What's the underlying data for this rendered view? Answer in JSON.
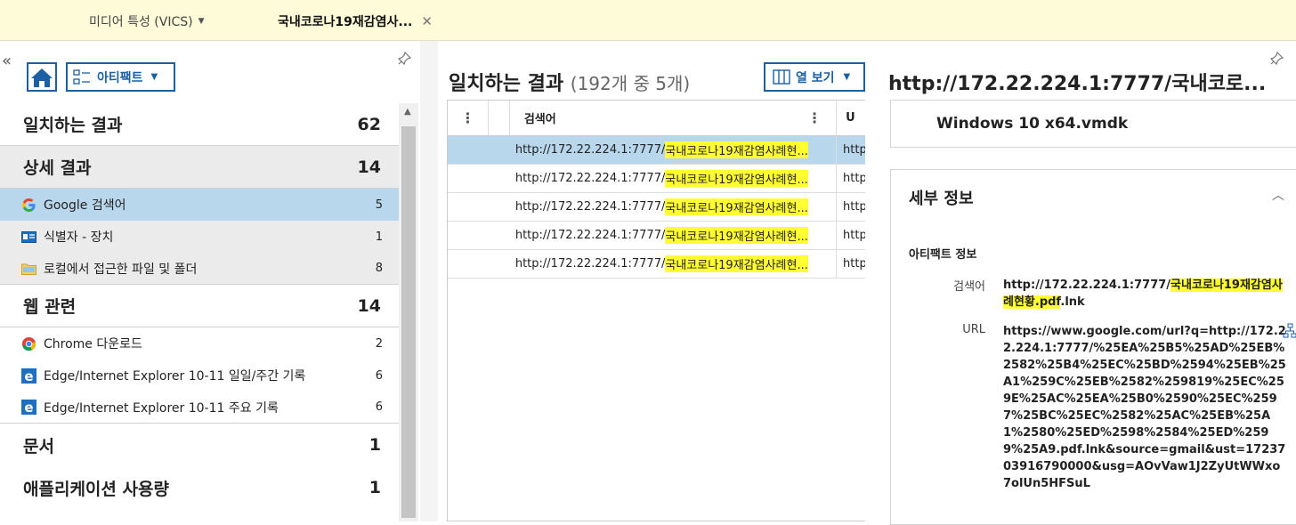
{
  "tabs": [
    {
      "label": "미디어 특성 (VICS)"
    },
    {
      "label": "국내코로나19재감염사..."
    }
  ],
  "left": {
    "artifact_button": "아티팩트",
    "categories": [
      {
        "label": "일치하는 결과",
        "count": "62"
      },
      {
        "label": "상세 결과",
        "count": "14"
      },
      {
        "label": "웹 관련",
        "count": "14"
      },
      {
        "label": "문서",
        "count": "1"
      },
      {
        "label": "애플리케이션 사용량",
        "count": "1"
      }
    ],
    "detail_items": [
      {
        "label": "Google 검색어",
        "count": "5",
        "icon": "google-icon"
      },
      {
        "label": "식별자 - 장치",
        "count": "1",
        "icon": "device-id-icon"
      },
      {
        "label": "로컬에서 접근한 파일 및 폴더",
        "count": "8",
        "icon": "folder-icon"
      }
    ],
    "web_items": [
      {
        "label": "Chrome 다운로드",
        "count": "2",
        "icon": "chrome-icon"
      },
      {
        "label": "Edge/Internet Explorer 10-11 일일/주간 기록",
        "count": "6",
        "icon": "ie-icon"
      },
      {
        "label": "Edge/Internet Explorer 10-11 주요 기록",
        "count": "6",
        "icon": "ie-icon"
      }
    ]
  },
  "middle": {
    "title": "일치하는 결과",
    "subtitle": "(192개 중 5개)",
    "column_button": "열 보기",
    "columns": [
      "검색어",
      "U"
    ],
    "rows": [
      {
        "prefix": "http://172.22.224.1:7777/",
        "hl": "국내코로나19재감염사례현...",
        "url": "http"
      },
      {
        "prefix": "http://172.22.224.1:7777/",
        "hl": "국내코로나19재감염사례현...",
        "url": "http"
      },
      {
        "prefix": "http://172.22.224.1:7777/",
        "hl": "국내코로나19재감염사례현...",
        "url": "http"
      },
      {
        "prefix": "http://172.22.224.1:7777/",
        "hl": "국내코로나19재감염사례현...",
        "url": "http"
      },
      {
        "prefix": "http://172.22.224.1:7777/",
        "hl": "국내코로나19재감염사례현...",
        "url": "http"
      }
    ]
  },
  "right": {
    "title": "http://172.22.224.1:7777/국내코로...",
    "device": "Windows 10 x64.vmdk",
    "details_header": "세부 정보",
    "section": "아티팩트 정보",
    "search_label": "검색어",
    "search_prefix": "http://172.22.224.1:7777/",
    "search_hl": "국내코로나19재감염사례현황.pdf",
    "search_suffix": ".lnk",
    "url_label": "URL",
    "url_value": "https://www.google.com/url?q=http://172.22.224.1:7777/%25EA%25B5%25AD%25EB%2582%25B4%25EC%25BD%2594%25EB%25A1%259C%25EB%2582%259819%25EC%259E%25AC%25EA%25B0%2590%25EC%2597%25BC%25EC%2582%25AC%25EB%25A1%2580%25ED%2598%2584%25ED%2599%25A9.pdf.lnk&source=gmail&ust=1723703916790000&usg=AOvVaw1J2ZyUtWWxo7olUn5HFSuL"
  }
}
